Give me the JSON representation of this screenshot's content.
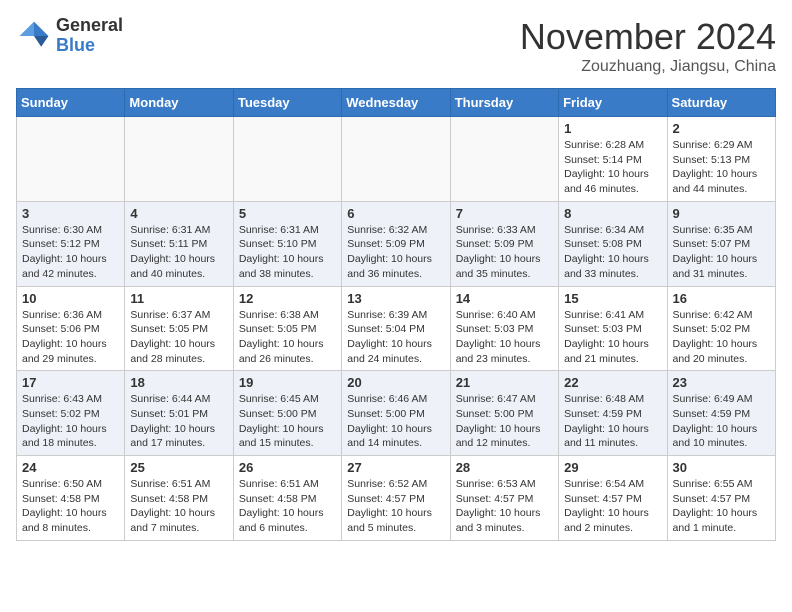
{
  "header": {
    "logo_general": "General",
    "logo_blue": "Blue",
    "month_title": "November 2024",
    "location": "Zouzhuang, Jiangsu, China"
  },
  "weekdays": [
    "Sunday",
    "Monday",
    "Tuesday",
    "Wednesday",
    "Thursday",
    "Friday",
    "Saturday"
  ],
  "weeks": [
    [
      {
        "day": "",
        "info": ""
      },
      {
        "day": "",
        "info": ""
      },
      {
        "day": "",
        "info": ""
      },
      {
        "day": "",
        "info": ""
      },
      {
        "day": "",
        "info": ""
      },
      {
        "day": "1",
        "info": "Sunrise: 6:28 AM\nSunset: 5:14 PM\nDaylight: 10 hours\nand 46 minutes."
      },
      {
        "day": "2",
        "info": "Sunrise: 6:29 AM\nSunset: 5:13 PM\nDaylight: 10 hours\nand 44 minutes."
      }
    ],
    [
      {
        "day": "3",
        "info": "Sunrise: 6:30 AM\nSunset: 5:12 PM\nDaylight: 10 hours\nand 42 minutes."
      },
      {
        "day": "4",
        "info": "Sunrise: 6:31 AM\nSunset: 5:11 PM\nDaylight: 10 hours\nand 40 minutes."
      },
      {
        "day": "5",
        "info": "Sunrise: 6:31 AM\nSunset: 5:10 PM\nDaylight: 10 hours\nand 38 minutes."
      },
      {
        "day": "6",
        "info": "Sunrise: 6:32 AM\nSunset: 5:09 PM\nDaylight: 10 hours\nand 36 minutes."
      },
      {
        "day": "7",
        "info": "Sunrise: 6:33 AM\nSunset: 5:09 PM\nDaylight: 10 hours\nand 35 minutes."
      },
      {
        "day": "8",
        "info": "Sunrise: 6:34 AM\nSunset: 5:08 PM\nDaylight: 10 hours\nand 33 minutes."
      },
      {
        "day": "9",
        "info": "Sunrise: 6:35 AM\nSunset: 5:07 PM\nDaylight: 10 hours\nand 31 minutes."
      }
    ],
    [
      {
        "day": "10",
        "info": "Sunrise: 6:36 AM\nSunset: 5:06 PM\nDaylight: 10 hours\nand 29 minutes."
      },
      {
        "day": "11",
        "info": "Sunrise: 6:37 AM\nSunset: 5:05 PM\nDaylight: 10 hours\nand 28 minutes."
      },
      {
        "day": "12",
        "info": "Sunrise: 6:38 AM\nSunset: 5:05 PM\nDaylight: 10 hours\nand 26 minutes."
      },
      {
        "day": "13",
        "info": "Sunrise: 6:39 AM\nSunset: 5:04 PM\nDaylight: 10 hours\nand 24 minutes."
      },
      {
        "day": "14",
        "info": "Sunrise: 6:40 AM\nSunset: 5:03 PM\nDaylight: 10 hours\nand 23 minutes."
      },
      {
        "day": "15",
        "info": "Sunrise: 6:41 AM\nSunset: 5:03 PM\nDaylight: 10 hours\nand 21 minutes."
      },
      {
        "day": "16",
        "info": "Sunrise: 6:42 AM\nSunset: 5:02 PM\nDaylight: 10 hours\nand 20 minutes."
      }
    ],
    [
      {
        "day": "17",
        "info": "Sunrise: 6:43 AM\nSunset: 5:02 PM\nDaylight: 10 hours\nand 18 minutes."
      },
      {
        "day": "18",
        "info": "Sunrise: 6:44 AM\nSunset: 5:01 PM\nDaylight: 10 hours\nand 17 minutes."
      },
      {
        "day": "19",
        "info": "Sunrise: 6:45 AM\nSunset: 5:00 PM\nDaylight: 10 hours\nand 15 minutes."
      },
      {
        "day": "20",
        "info": "Sunrise: 6:46 AM\nSunset: 5:00 PM\nDaylight: 10 hours\nand 14 minutes."
      },
      {
        "day": "21",
        "info": "Sunrise: 6:47 AM\nSunset: 5:00 PM\nDaylight: 10 hours\nand 12 minutes."
      },
      {
        "day": "22",
        "info": "Sunrise: 6:48 AM\nSunset: 4:59 PM\nDaylight: 10 hours\nand 11 minutes."
      },
      {
        "day": "23",
        "info": "Sunrise: 6:49 AM\nSunset: 4:59 PM\nDaylight: 10 hours\nand 10 minutes."
      }
    ],
    [
      {
        "day": "24",
        "info": "Sunrise: 6:50 AM\nSunset: 4:58 PM\nDaylight: 10 hours\nand 8 minutes."
      },
      {
        "day": "25",
        "info": "Sunrise: 6:51 AM\nSunset: 4:58 PM\nDaylight: 10 hours\nand 7 minutes."
      },
      {
        "day": "26",
        "info": "Sunrise: 6:51 AM\nSunset: 4:58 PM\nDaylight: 10 hours\nand 6 minutes."
      },
      {
        "day": "27",
        "info": "Sunrise: 6:52 AM\nSunset: 4:57 PM\nDaylight: 10 hours\nand 5 minutes."
      },
      {
        "day": "28",
        "info": "Sunrise: 6:53 AM\nSunset: 4:57 PM\nDaylight: 10 hours\nand 3 minutes."
      },
      {
        "day": "29",
        "info": "Sunrise: 6:54 AM\nSunset: 4:57 PM\nDaylight: 10 hours\nand 2 minutes."
      },
      {
        "day": "30",
        "info": "Sunrise: 6:55 AM\nSunset: 4:57 PM\nDaylight: 10 hours\nand 1 minute."
      }
    ]
  ]
}
